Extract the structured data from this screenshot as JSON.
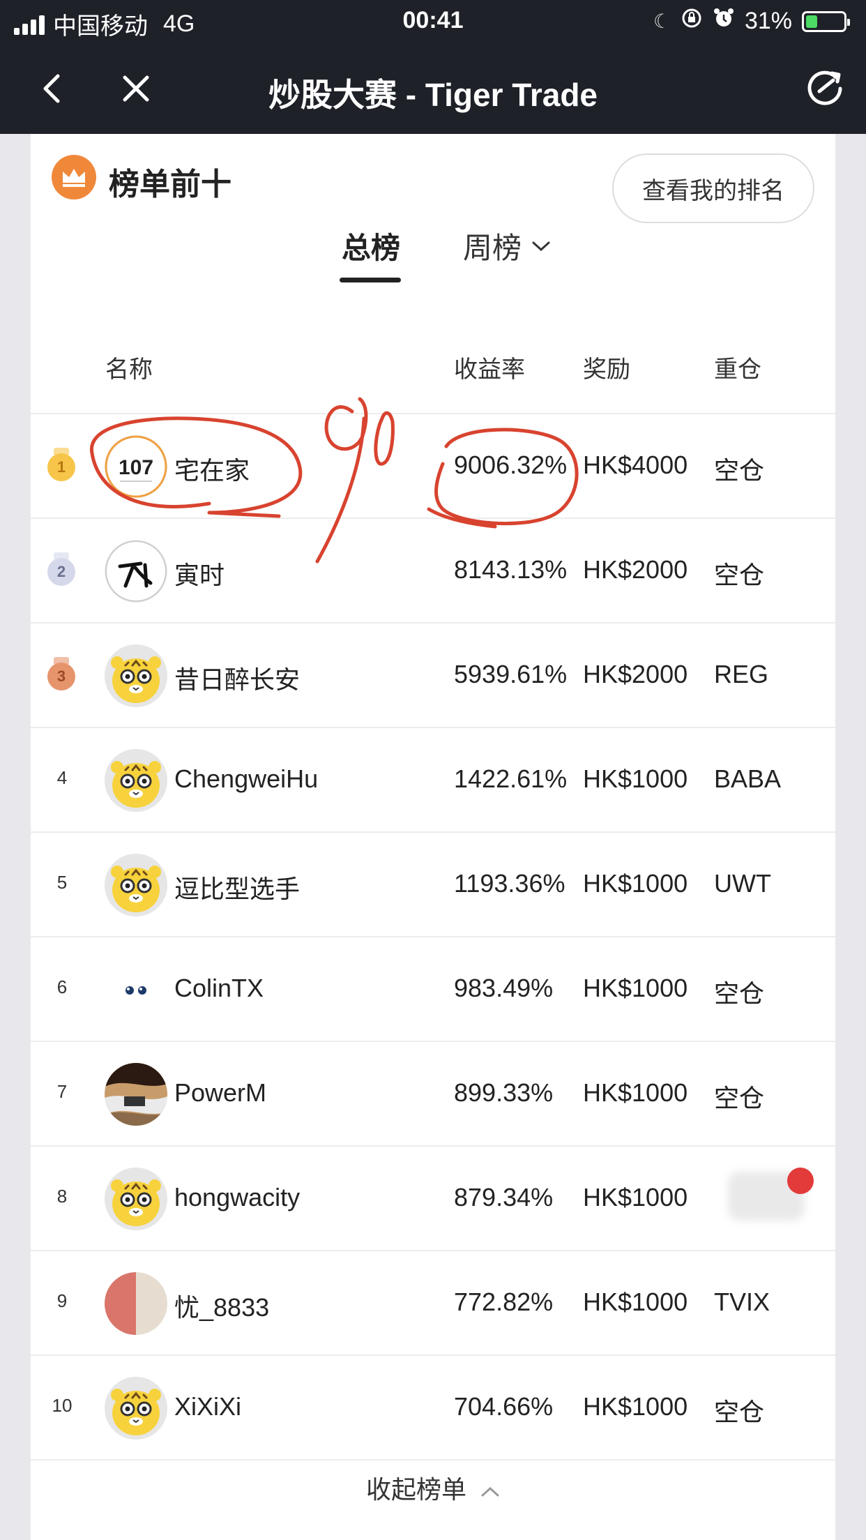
{
  "status": {
    "carrier": "中国移动",
    "network": "4G",
    "time": "00:41",
    "battery_text": "31%",
    "battery_level": 0.31
  },
  "nav": {
    "title": "炒股大赛 - Tiger Trade"
  },
  "card": {
    "title": "榜单前十",
    "my_rank_button": "查看我的排名",
    "tabs": {
      "total": "总榜",
      "weekly": "周榜"
    }
  },
  "table": {
    "headers": {
      "name": "名称",
      "yield": "收益率",
      "reward": "奖励",
      "position": "重仓"
    },
    "rows": [
      {
        "rank": "1",
        "name": "宅在家",
        "yield": "9006.32%",
        "reward": "HK$4000",
        "position": "空仓",
        "avatar": "badge-107",
        "avatar_text": "107"
      },
      {
        "rank": "2",
        "name": "寅时",
        "yield": "8143.13%",
        "reward": "HK$2000",
        "position": "空仓",
        "avatar": "calligraphy"
      },
      {
        "rank": "3",
        "name": "昔日醉长安",
        "yield": "5939.61%",
        "reward": "HK$2000",
        "position": "REG",
        "avatar": "tiger"
      },
      {
        "rank": "4",
        "name": "ChengweiHu",
        "yield": "1422.61%",
        "reward": "HK$1000",
        "position": "BABA",
        "avatar": "tiger"
      },
      {
        "rank": "5",
        "name": "逗比型选手",
        "yield": "1193.36%",
        "reward": "HK$1000",
        "position": "UWT",
        "avatar": "tiger"
      },
      {
        "rank": "6",
        "name": "ColinTX",
        "yield": "983.49%",
        "reward": "HK$1000",
        "position": "空仓",
        "avatar": "eyes"
      },
      {
        "rank": "7",
        "name": "PowerM",
        "yield": "899.33%",
        "reward": "HK$1000",
        "position": "空仓",
        "avatar": "photo"
      },
      {
        "rank": "8",
        "name": "hongwacity",
        "yield": "879.34%",
        "reward": "HK$1000",
        "position": "",
        "avatar": "tiger"
      },
      {
        "rank": "9",
        "name": "忧_8833",
        "yield": "772.82%",
        "reward": "HK$1000",
        "position": "TVIX",
        "avatar": "pink"
      },
      {
        "rank": "10",
        "name": "XiXiXi",
        "yield": "704.66%",
        "reward": "HK$1000",
        "position": "空仓",
        "avatar": "tiger"
      }
    ]
  },
  "collapse_label": "收起榜单",
  "annotation": {
    "handwritten_text": "90",
    "color": "#d8432f"
  }
}
